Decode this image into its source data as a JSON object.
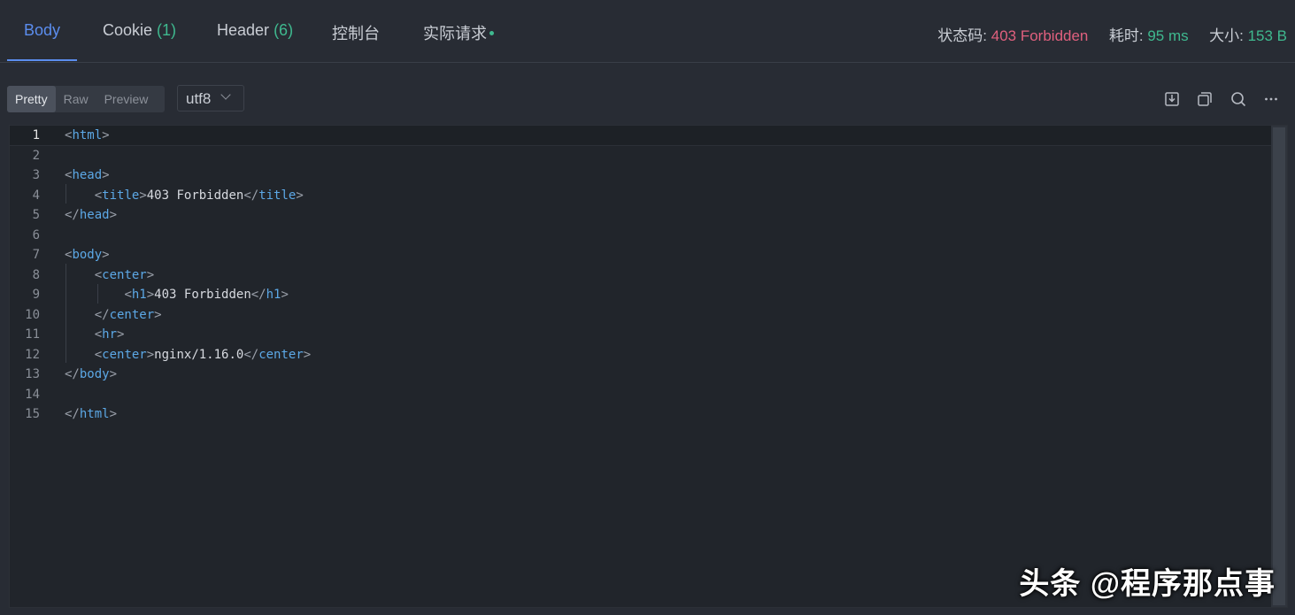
{
  "tabs": [
    {
      "label": "Body",
      "count": ""
    },
    {
      "label": "Cookie",
      "count": "(1)"
    },
    {
      "label": "Header",
      "count": "(6)"
    },
    {
      "label": "控制台",
      "count": ""
    },
    {
      "label": "实际请求",
      "count": ""
    }
  ],
  "status": {
    "code_label": "状态码:",
    "code_value": "403 Forbidden",
    "time_label": "耗时:",
    "time_value": "95 ms",
    "size_label": "大小:",
    "size_value": "153 B"
  },
  "toolbar": {
    "view_modes": [
      "Pretty",
      "Raw",
      "Preview"
    ],
    "selected_view": "Pretty",
    "encoding": "utf8",
    "icons": [
      "save-icon",
      "copy-icon",
      "search-icon",
      "more-icon"
    ]
  },
  "colors": {
    "accent": "#5b8dee",
    "success": "#3fb98f",
    "error": "#e0607e",
    "tag": "#5ca8e6"
  },
  "editor": {
    "lines": [
      {
        "n": "1",
        "text": "<html>"
      },
      {
        "n": "2",
        "text": ""
      },
      {
        "n": "3",
        "text": "<head>"
      },
      {
        "n": "4",
        "text": "    <title>403 Forbidden</title>"
      },
      {
        "n": "5",
        "text": "</head>"
      },
      {
        "n": "6",
        "text": ""
      },
      {
        "n": "7",
        "text": "<body>"
      },
      {
        "n": "8",
        "text": "    <center>"
      },
      {
        "n": "9",
        "text": "        <h1>403 Forbidden</h1>"
      },
      {
        "n": "10",
        "text": "    </center>"
      },
      {
        "n": "11",
        "text": "    <hr>"
      },
      {
        "n": "12",
        "text": "    <center>nginx/1.16.0</center>"
      },
      {
        "n": "13",
        "text": "</body>"
      },
      {
        "n": "14",
        "text": ""
      },
      {
        "n": "15",
        "text": "</html>"
      }
    ]
  },
  "watermark": "头条 @程序那点事"
}
